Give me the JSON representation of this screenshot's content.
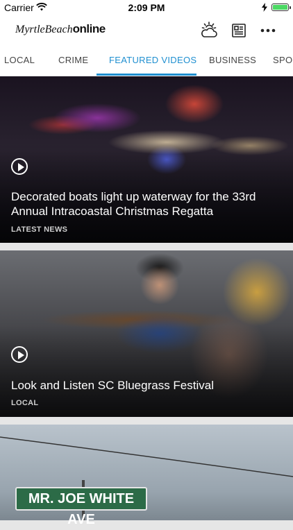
{
  "status_bar": {
    "carrier": "Carrier",
    "time": "2:09 PM"
  },
  "app": {
    "logo_part1": "MyrtleBeach",
    "logo_part2": "online",
    "header_icons": [
      "weather-icon",
      "newspaper-icon",
      "more-icon"
    ]
  },
  "tabs": [
    {
      "label": "LOCAL",
      "active": false
    },
    {
      "label": "CRIME",
      "active": false
    },
    {
      "label": "FEATURED VIDEOS",
      "active": true
    },
    {
      "label": "BUSINESS",
      "active": false
    },
    {
      "label": "SPOR",
      "active": false
    }
  ],
  "cards": [
    {
      "headline": "Decorated boats light up waterway for the 33rd Annual Intracoastal Christmas Regatta",
      "section": "LATEST NEWS",
      "has_video": true
    },
    {
      "headline": "Look and Listen SC Bluegrass Festival",
      "section": "LOCAL",
      "has_video": true
    },
    {
      "sign_text": "MR. JOE WHITE AVE"
    }
  ],
  "colors": {
    "accent": "#1f8fd0",
    "battery": "#4cd964",
    "sign_green": "#2c6b47"
  }
}
